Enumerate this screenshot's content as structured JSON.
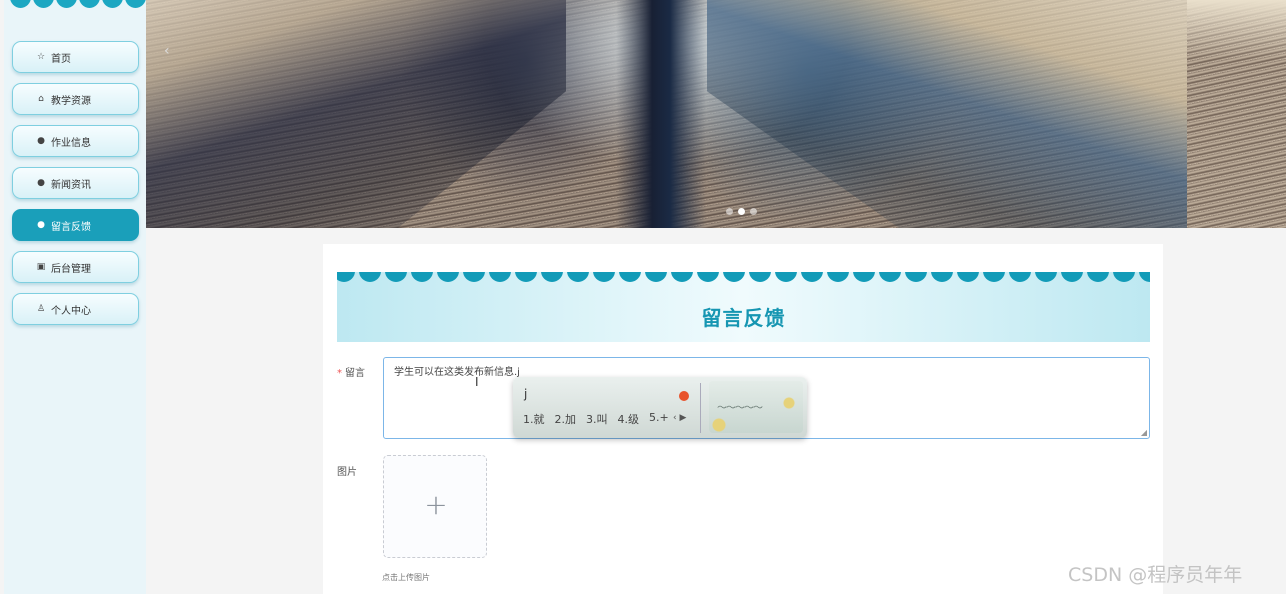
{
  "sidebar": {
    "items": [
      {
        "label": "首页",
        "icon": "star-icon"
      },
      {
        "label": "教学资源",
        "icon": "home-icon"
      },
      {
        "label": "作业信息",
        "icon": "info-circle-icon"
      },
      {
        "label": "新闻资讯",
        "icon": "question-circle-icon"
      },
      {
        "label": "留言反馈",
        "icon": "info-circle-icon",
        "active": true
      },
      {
        "label": "后台管理",
        "icon": "calendar-icon"
      },
      {
        "label": "个人中心",
        "icon": "user-icon"
      }
    ]
  },
  "banner": {
    "prev_arrow": "‹",
    "slides_total": 3,
    "slide_active": 2
  },
  "form": {
    "title": "留言反馈",
    "message_label": "留言",
    "message_value": "学生可以在这类发布新信息.j",
    "image_label": "图片",
    "upload_plus": "+",
    "upload_hint": "点击上传图片"
  },
  "ime": {
    "input": "j",
    "candidates": [
      "1.就",
      "2.加",
      "3.叫",
      "4.级",
      "5.+"
    ]
  },
  "watermark": "CSDN @程序员年年",
  "colors": {
    "accent": "#1a9fba",
    "title": "#1696b2",
    "required": "#e55555"
  }
}
